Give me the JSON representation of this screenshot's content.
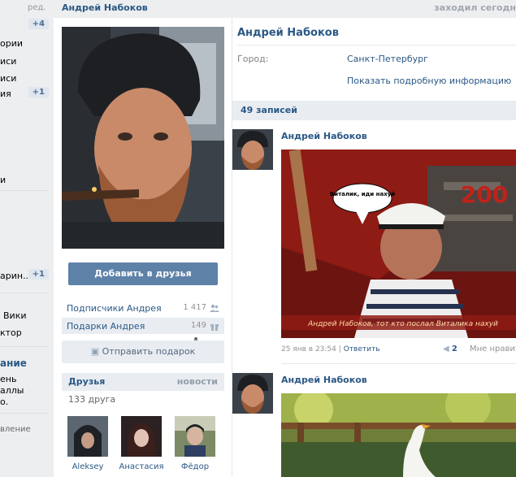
{
  "sidebar": {
    "top_link": "ред.",
    "items": [
      {
        "label": "",
        "badge": "+4"
      },
      {
        "label": "ории",
        "badge": ""
      },
      {
        "label": "иси",
        "badge": ""
      },
      {
        "label": "иси",
        "badge": ""
      },
      {
        "label": "ия",
        "badge": "+1"
      },
      {
        "label": "и",
        "badge": ""
      },
      {
        "label": "арин..",
        "badge": "+1"
      },
      {
        "label": "Вики",
        "badge": ""
      },
      {
        "label": "ктор",
        "badge": ""
      },
      {
        "label": "ень",
        "badge": ""
      },
      {
        "label": "аллы",
        "badge": ""
      },
      {
        "label": "о.",
        "badge": ""
      },
      {
        "label": "вление",
        "badge": ""
      }
    ],
    "section_title": "ание"
  },
  "header": {
    "name": "Андрей Набоков",
    "status": "заходил сегодн"
  },
  "profile": {
    "add_friend_button": "Добавить в друзья",
    "rows": [
      {
        "label": "Подписчики Андрея",
        "count": "1 417",
        "icon": "followers-icon"
      },
      {
        "label": "Подарки Андрея",
        "count": "149",
        "icon": "gift-icon"
      }
    ],
    "send_gift_button": "Отправить подарок"
  },
  "friends": {
    "title": "Друзья",
    "link": "новости",
    "count": "133 друга",
    "list": [
      {
        "name": "Aleksey"
      },
      {
        "name": "Анастасия"
      },
      {
        "name": "Фёдор"
      }
    ]
  },
  "info": {
    "name": "Андрей Набоков",
    "city_label": "Город:",
    "city_value": "Санкт-Петербург",
    "more_link": "Показать подробную информацию"
  },
  "wall": {
    "title": "49 записей",
    "posts": [
      {
        "author": "Андрей Набоков",
        "bubble_text": "Виталик, иди нахуй",
        "banner_number": "200",
        "caption": "Андрей Набоков, тот кто послал Виталика нахуй",
        "date": "25 янв в 23:54",
        "separator": "|",
        "reply": "Ответить",
        "share_count": "2",
        "like_text": "Мне нравится"
      },
      {
        "author": "Андрей Набоков"
      }
    ]
  },
  "colors": {
    "link": "#2a5885",
    "button": "#5e81a8",
    "background": "#edeef0"
  }
}
